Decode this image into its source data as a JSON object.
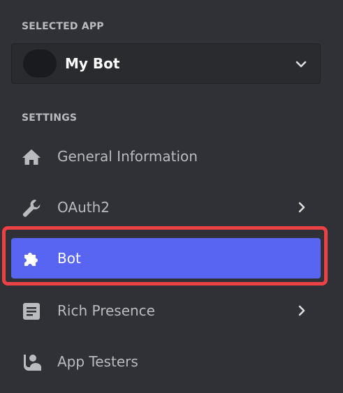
{
  "selected_app": {
    "section_label": "SELECTED APP",
    "app_name": "My Bot",
    "chevron_icon": "chevron-down-icon"
  },
  "settings": {
    "section_label": "SETTINGS",
    "items": [
      {
        "label": "General Information",
        "icon": "home-icon",
        "has_chevron": false,
        "active": false
      },
      {
        "label": "OAuth2",
        "icon": "wrench-icon",
        "has_chevron": true,
        "active": false
      },
      {
        "label": "Bot",
        "icon": "puzzle-icon",
        "has_chevron": false,
        "active": true
      },
      {
        "label": "Rich Presence",
        "icon": "document-icon",
        "has_chevron": true,
        "active": false
      },
      {
        "label": "App Testers",
        "icon": "person-icon",
        "has_chevron": false,
        "active": false
      }
    ]
  },
  "colors": {
    "background": "#2f3136",
    "active_item": "#5865f2",
    "highlight_border": "#ed4245",
    "text_muted": "#b9bbbe",
    "text_active": "#ffffff"
  }
}
